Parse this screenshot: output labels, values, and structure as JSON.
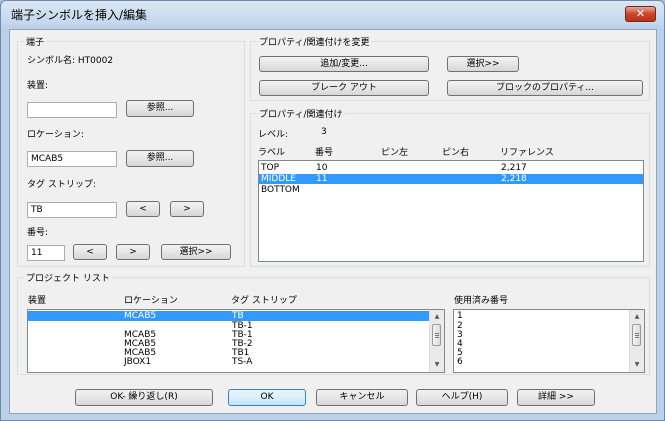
{
  "window": {
    "title": "端子シンボルを挿入/編集",
    "close_glyph": "✕"
  },
  "terminal": {
    "group_label": "端子",
    "symbol_name_label": "シンボル名: HT0002",
    "device_label": "装置:",
    "device_value": "",
    "device_browse": "参照...",
    "location_label": "ロケーション:",
    "location_value": "MCAB5",
    "location_browse": "参照...",
    "tagstrip_label": "タグ ストリップ:",
    "tagstrip_value": "TB",
    "prev_glyph": "<",
    "next_glyph": ">",
    "number_label": "番号:",
    "number_value": "11",
    "select_button": "選択>>"
  },
  "change_props": {
    "group_label": "プロパティ/関連付けを変更",
    "add_change": "追加/変更...",
    "select": "選択>>",
    "break_out": "ブレーク アウト",
    "block_props": "ブロックのプロパティ..."
  },
  "props": {
    "group_label": "プロパティ/関連付け",
    "level_label": "レベル:",
    "level_value": "3",
    "columns": [
      "ラベル",
      "番号",
      "ピン左",
      "ピン右",
      "リファレンス"
    ],
    "rows": [
      {
        "label": "TOP",
        "number": "10",
        "pin_left": "",
        "pin_right": "",
        "reference": "2,217",
        "selected": false
      },
      {
        "label": "MIDDLE",
        "number": "11",
        "pin_left": "",
        "pin_right": "",
        "reference": "2,218",
        "selected": true
      },
      {
        "label": "BOTTOM",
        "number": "",
        "pin_left": "",
        "pin_right": "",
        "reference": "",
        "selected": false
      }
    ]
  },
  "project_list": {
    "group_label": "プロジェクト リスト",
    "columns": [
      "装置",
      "ロケーション",
      "タグ ストリップ"
    ],
    "used_numbers_label": "使用済み番号",
    "rows": [
      {
        "device": "",
        "location": "MCAB5",
        "tagstrip": "TB",
        "selected": true
      },
      {
        "device": "",
        "location": "",
        "tagstrip": "TB-1",
        "selected": false
      },
      {
        "device": "",
        "location": "MCAB5",
        "tagstrip": "TB-1",
        "selected": false
      },
      {
        "device": "",
        "location": "MCAB5",
        "tagstrip": "TB-2",
        "selected": false
      },
      {
        "device": "",
        "location": "MCAB5",
        "tagstrip": "TB1",
        "selected": false
      },
      {
        "device": "",
        "location": "JBOX1",
        "tagstrip": "TS-A",
        "selected": false
      }
    ],
    "used_numbers": [
      "1",
      "2",
      "3",
      "4",
      "5",
      "6"
    ]
  },
  "footer": {
    "ok_repeat": "OK- 繰り返し(R)",
    "ok": "OK",
    "cancel": "キャンセル",
    "help": "ヘルプ(H)",
    "details": "詳細 >>"
  }
}
